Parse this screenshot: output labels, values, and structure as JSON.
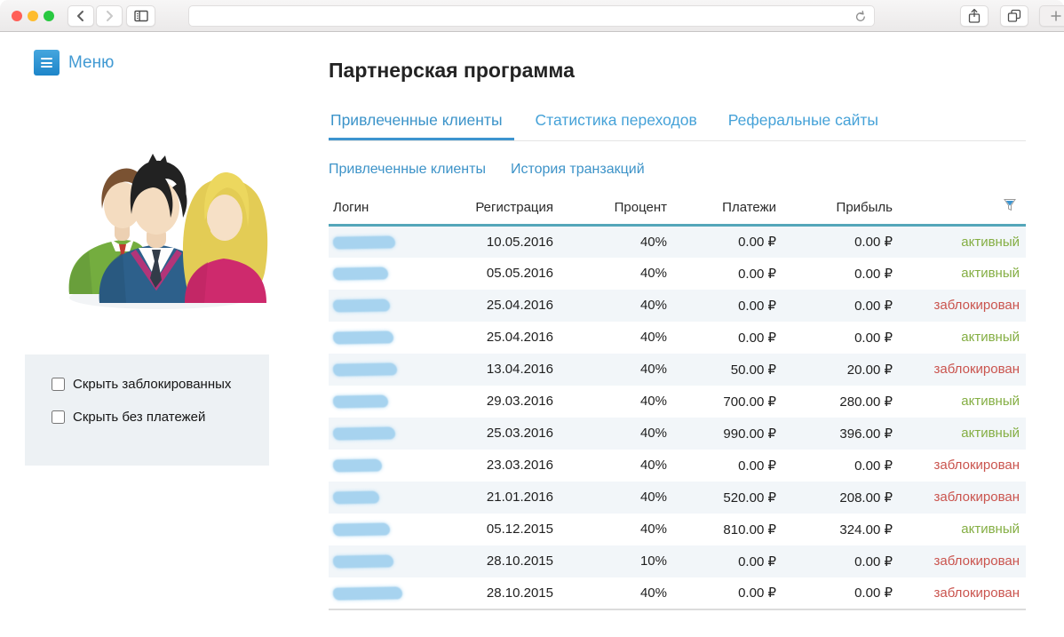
{
  "browser": {
    "url_value": "",
    "url_placeholder": ""
  },
  "sidebar": {
    "menu_label": "Меню",
    "filters": [
      {
        "label": "Скрыть заблокированных",
        "checked": false
      },
      {
        "label": "Скрыть без платежей",
        "checked": false
      }
    ]
  },
  "main": {
    "title": "Партнерская программа",
    "tabs": [
      {
        "id": "attracted-clients",
        "label": "Привлеченные клиенты",
        "active": true
      },
      {
        "id": "transition-stats",
        "label": "Статистика переходов",
        "active": false
      },
      {
        "id": "referral-sites",
        "label": "Реферальные сайты",
        "active": false
      }
    ],
    "subtabs": [
      {
        "id": "attracted-clients",
        "label": "Привлеченные клиенты",
        "active": true
      },
      {
        "id": "transaction-history",
        "label": "История транзакций",
        "active": false
      }
    ]
  },
  "table": {
    "columns": [
      "Логин",
      "Регистрация",
      "Процент",
      "Платежи",
      "Прибыль"
    ],
    "filter_icon": "funnel-icon",
    "status_labels": {
      "active": "активный",
      "blocked": "заблокирован"
    },
    "rows": [
      {
        "registration": "10.05.2016",
        "percent": "40%",
        "payments": "0.00 ₽",
        "profit": "0.00 ₽",
        "status": "active",
        "status_label": "активный",
        "login_blur_width": 70
      },
      {
        "registration": "05.05.2016",
        "percent": "40%",
        "payments": "0.00 ₽",
        "profit": "0.00 ₽",
        "status": "active",
        "status_label": "активный",
        "login_blur_width": 62
      },
      {
        "registration": "25.04.2016",
        "percent": "40%",
        "payments": "0.00 ₽",
        "profit": "0.00 ₽",
        "status": "blocked",
        "status_label": "заблокирован",
        "login_blur_width": 64
      },
      {
        "registration": "25.04.2016",
        "percent": "40%",
        "payments": "0.00 ₽",
        "profit": "0.00 ₽",
        "status": "active",
        "status_label": "активный",
        "login_blur_width": 68
      },
      {
        "registration": "13.04.2016",
        "percent": "40%",
        "payments": "50.00 ₽",
        "profit": "20.00 ₽",
        "status": "blocked",
        "status_label": "заблокирован",
        "login_blur_width": 72
      },
      {
        "registration": "29.03.2016",
        "percent": "40%",
        "payments": "700.00 ₽",
        "profit": "280.00 ₽",
        "status": "active",
        "status_label": "активный",
        "login_blur_width": 62
      },
      {
        "registration": "25.03.2016",
        "percent": "40%",
        "payments": "990.00 ₽",
        "profit": "396.00 ₽",
        "status": "active",
        "status_label": "активный",
        "login_blur_width": 70
      },
      {
        "registration": "23.03.2016",
        "percent": "40%",
        "payments": "0.00 ₽",
        "profit": "0.00 ₽",
        "status": "blocked",
        "status_label": "заблокирован",
        "login_blur_width": 55
      },
      {
        "registration": "21.01.2016",
        "percent": "40%",
        "payments": "520.00 ₽",
        "profit": "208.00 ₽",
        "status": "blocked",
        "status_label": "заблокирован",
        "login_blur_width": 52
      },
      {
        "registration": "05.12.2015",
        "percent": "40%",
        "payments": "810.00 ₽",
        "profit": "324.00 ₽",
        "status": "active",
        "status_label": "активный",
        "login_blur_width": 64
      },
      {
        "registration": "28.10.2015",
        "percent": "10%",
        "payments": "0.00 ₽",
        "profit": "0.00 ₽",
        "status": "blocked",
        "status_label": "заблокирован",
        "login_blur_width": 68
      },
      {
        "registration": "28.10.2015",
        "percent": "40%",
        "payments": "0.00 ₽",
        "profit": "0.00 ₽",
        "status": "blocked",
        "status_label": "заблокирован",
        "login_blur_width": 78
      }
    ]
  },
  "theme": {
    "accent_blue": "#3d94cf",
    "table_header_line": "#54a6ba",
    "status_active_color": "#84ae43",
    "status_blocked_color": "#ca544e",
    "row_alt_bg": "#f2f6f9",
    "login_blur_color": "#a7d3ef",
    "traffic_red": "#ff5f57",
    "traffic_yellow": "#febc2e",
    "traffic_green": "#28c840"
  }
}
